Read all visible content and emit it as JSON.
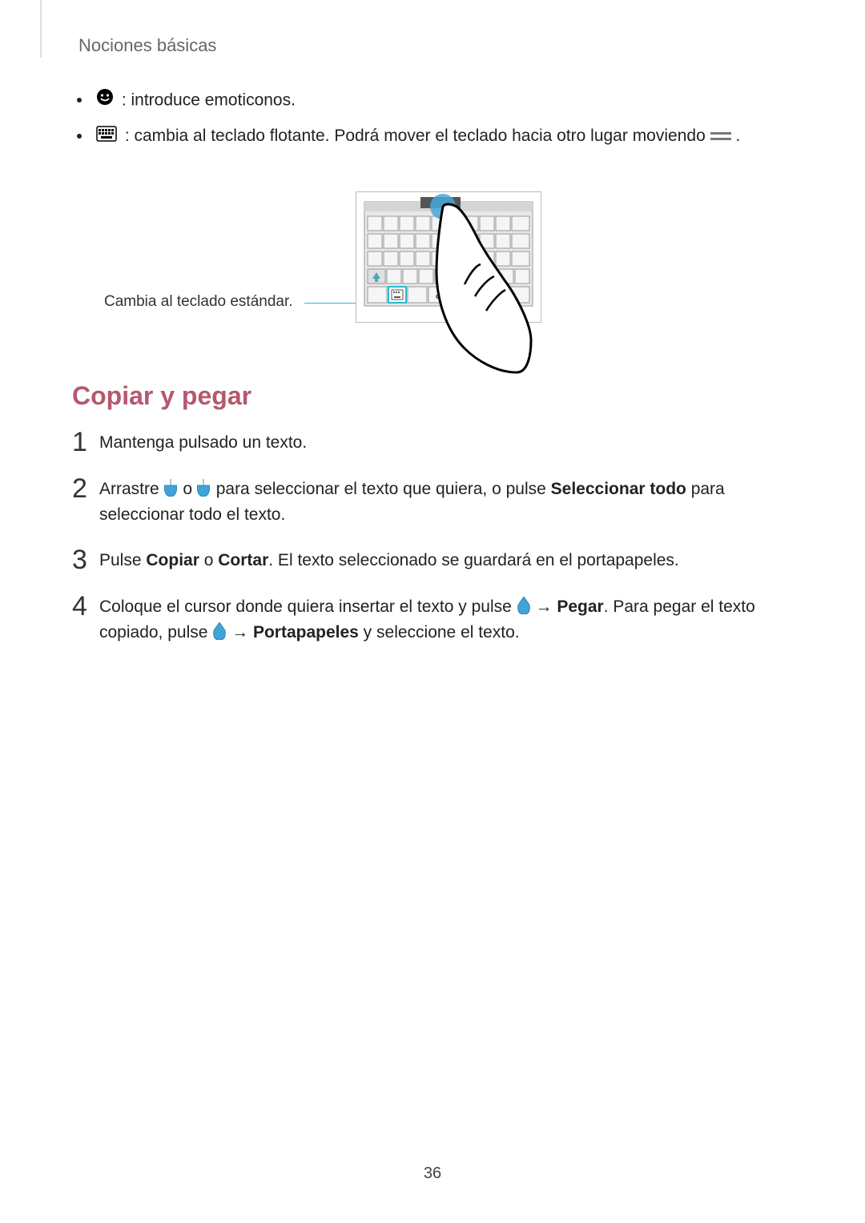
{
  "header": "Nociones básicas",
  "bullets": {
    "b1": " : introduce emoticonos.",
    "b2": " : cambia al teclado flotante. Podrá mover el teclado hacia otro lugar moviendo ",
    "b2_end": "."
  },
  "caption": "Cambia al teclado estándar.",
  "section_title": "Copiar y pegar",
  "steps": {
    "n1": "1",
    "s1": "Mantenga pulsado un texto.",
    "n2": "2",
    "s2_a": "Arrastre ",
    "s2_b": " o ",
    "s2_c": " para seleccionar el texto que quiera, o pulse ",
    "s2_bold1": "Seleccionar todo",
    "s2_d": " para seleccionar todo el texto.",
    "n3": "3",
    "s3_a": "Pulse ",
    "s3_bold1": "Copiar",
    "s3_b": " o ",
    "s3_bold2": "Cortar",
    "s3_c": ". El texto seleccionado se guardará en el portapapeles.",
    "n4": "4",
    "s4_a": "Coloque el cursor donde quiera insertar el texto y pulse ",
    "s4_arrow1": " → ",
    "s4_bold1": "Pegar",
    "s4_b": ". Para pegar el texto copiado, pulse ",
    "s4_arrow2": " → ",
    "s4_bold2": "Portapapeles",
    "s4_c": " y seleccione el texto."
  },
  "page_number": "36"
}
